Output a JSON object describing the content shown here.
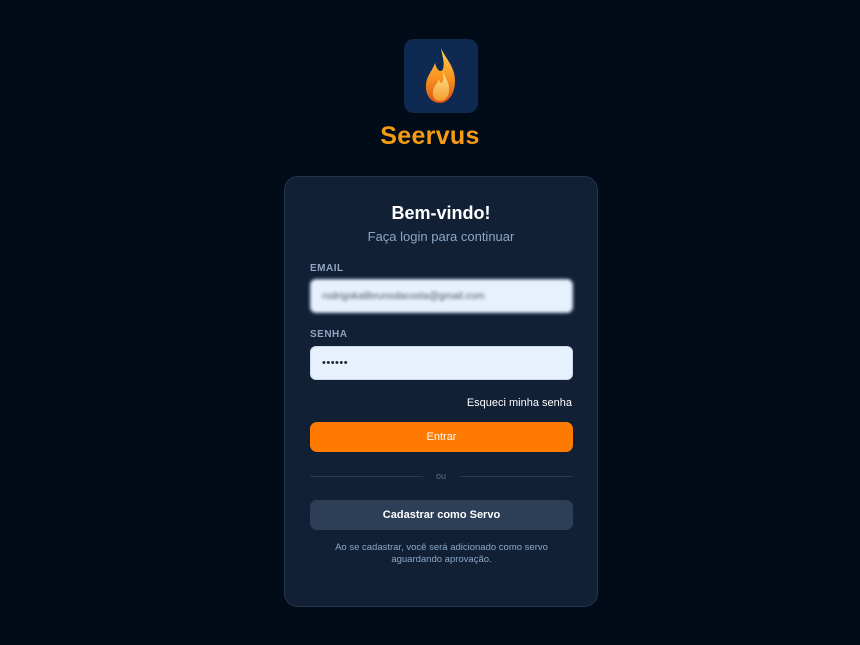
{
  "brand": {
    "name": "Seervus",
    "logo_icon": "flame-icon",
    "accent_color": "#f59b12"
  },
  "login": {
    "title": "Bem-vindo!",
    "subtitle": "Faça login para continuar",
    "email_label": "EMAIL",
    "email_value": "rodrigokalibrunodacosta@gmail.com",
    "password_label": "SENHA",
    "password_value": "••••••",
    "forgot_link": "Esqueci minha senha",
    "submit_label": "Entrar",
    "divider_text": "ou",
    "register_label": "Cadastrar como Servo",
    "note": "Ao se cadastrar, você será adicionado como servo aguardando aprovação.",
    "primary_color": "#ff7a00"
  }
}
